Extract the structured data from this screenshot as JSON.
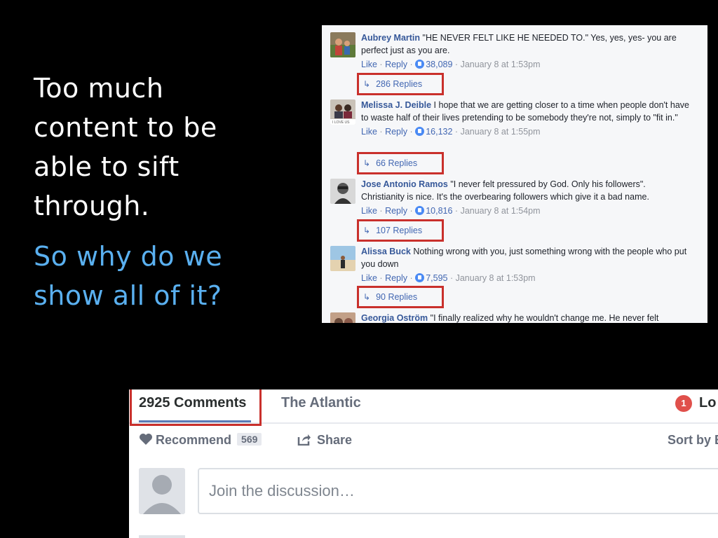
{
  "slide": {
    "lines_white": [
      "Too much",
      "content to be",
      "able to sift",
      "through."
    ],
    "lines_blue": [
      "So why do we",
      "show all of it?"
    ]
  },
  "facebook": {
    "comments": [
      {
        "name": "Aubrey Martin",
        "text": "\"HE NEVER FELT LIKE HE NEEDED TO.\" Yes, yes, yes- you are perfect just as you are.",
        "like": "Like",
        "reply": "Reply",
        "likes": "38,089",
        "time": "January 8 at 1:53pm",
        "replies": "286 Replies"
      },
      {
        "name": "Melissa J. Deible",
        "text": "I hope that we are getting closer to a time when people don't have to waste half of their lives pretending to be somebody they're not, simply to \"fit in.\"",
        "like": "Like",
        "reply": "Reply",
        "likes": "16,132",
        "time": "January 8 at 1:55pm",
        "replies": "66 Replies"
      },
      {
        "name": "Jose Antonio Ramos",
        "text": "\"I never felt pressured by God. Only his followers\". Christianity is nice. It's the overbearing followers which give it a bad name.",
        "like": "Like",
        "reply": "Reply",
        "likes": "10,816",
        "time": "January 8 at 1:54pm",
        "replies": "107 Replies"
      },
      {
        "name": "Alissa Buck",
        "text": "Nothing wrong with you, just something wrong with the people who put you down",
        "like": "Like",
        "reply": "Reply",
        "likes": "7,595",
        "time": "January 8 at 1:53pm",
        "replies": "90 Replies"
      },
      {
        "name": "Georgia Oström",
        "text": "\"I finally realized why he wouldn't change me. He never felt"
      }
    ],
    "separator": "·"
  },
  "disqus": {
    "comments_tab": "2925 Comments",
    "site_tab": "The Atlantic",
    "notification_count": "1",
    "login_label": "Lo",
    "recommend_label": "Recommend",
    "recommend_count": "569",
    "share_label": "Share",
    "sort_label": "Sort by B",
    "input_placeholder": "Join the discussion…"
  },
  "colors": {
    "highlight_red": "#c9302c",
    "fb_link": "#365899",
    "slide_blue": "#5ab0f0"
  }
}
